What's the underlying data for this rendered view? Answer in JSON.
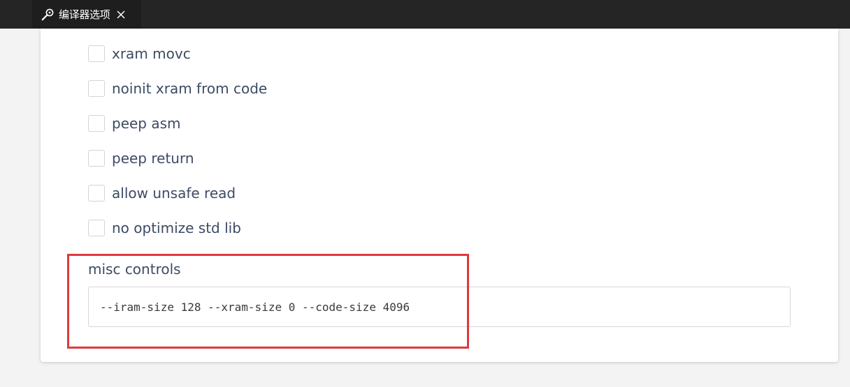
{
  "tab": {
    "title": "编译器选项",
    "icon": "wrench-icon",
    "close_icon": "close-icon"
  },
  "options": [
    {
      "label": "xram movc",
      "checked": false
    },
    {
      "label": "noinit xram from code",
      "checked": false
    },
    {
      "label": "peep asm",
      "checked": false
    },
    {
      "label": "peep return",
      "checked": false
    },
    {
      "label": "allow unsafe read",
      "checked": false
    },
    {
      "label": "no optimize std lib",
      "checked": false
    }
  ],
  "misc": {
    "label": "misc controls",
    "value": "--iram-size 128 --xram-size 0 --code-size 4096"
  },
  "colors": {
    "titlebar": "#252526",
    "tab_active": "#1e1e1e",
    "label_text": "#3c4b63",
    "highlight": "#e0393e"
  }
}
